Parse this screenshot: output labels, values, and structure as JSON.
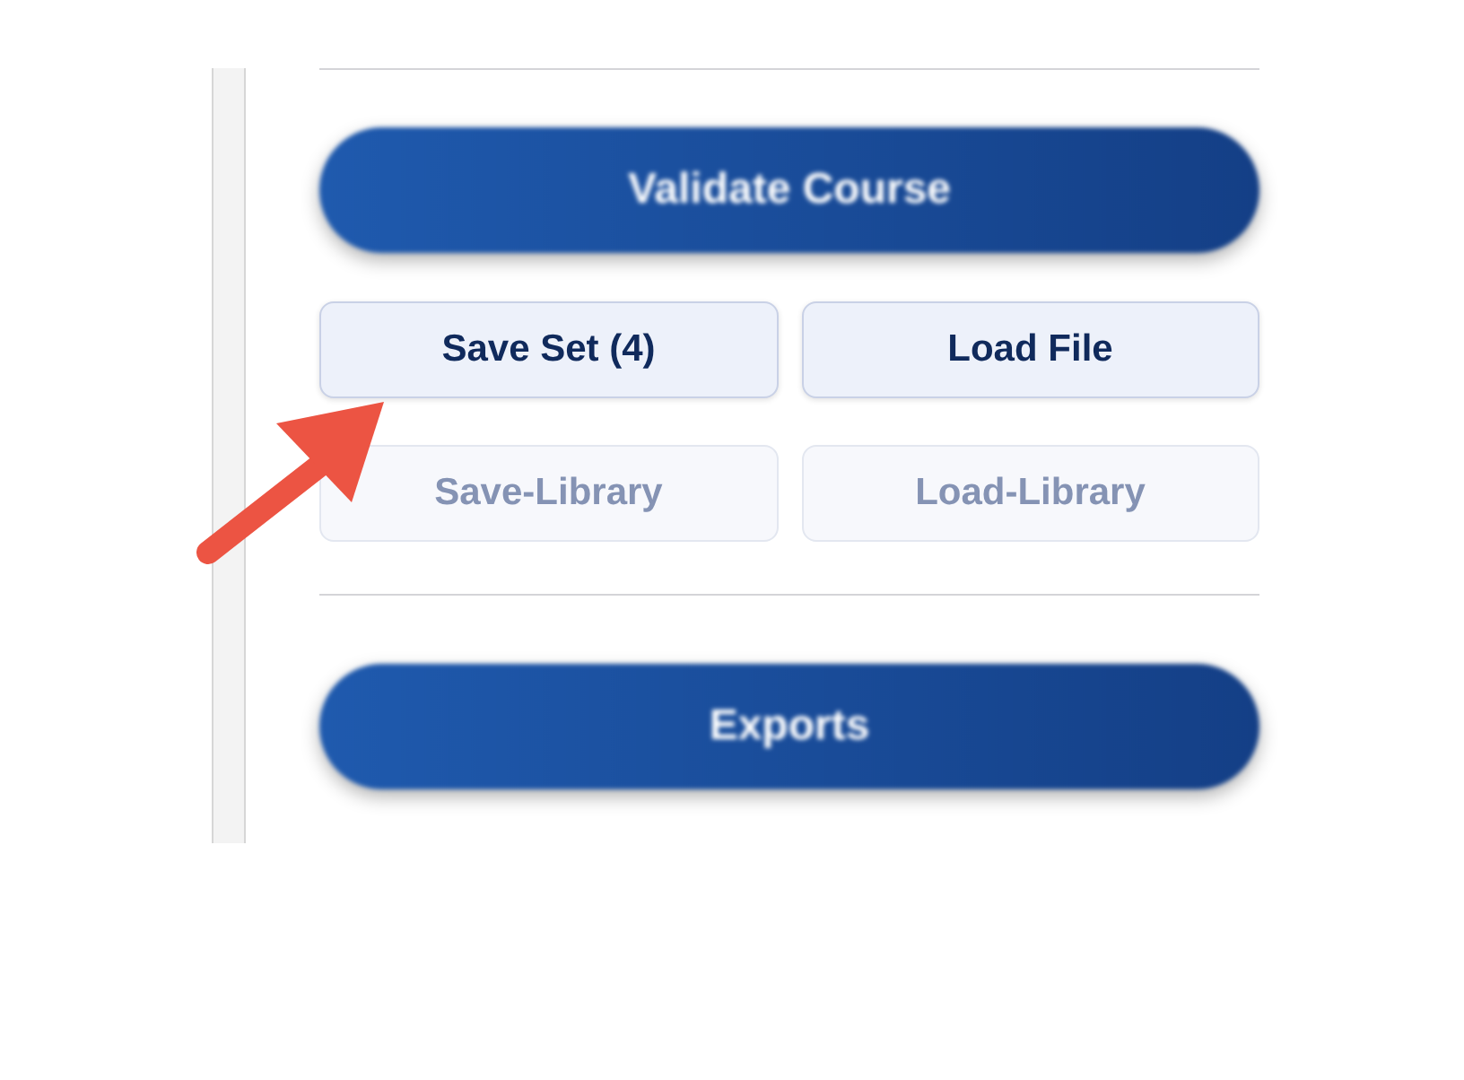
{
  "validate_button": {
    "label": "Validate Course"
  },
  "file_buttons": [
    {
      "label": "Save Set (4)",
      "disabled": false
    },
    {
      "label": "Load File",
      "disabled": false
    },
    {
      "label": "Save-Library",
      "disabled": true
    },
    {
      "label": "Load-Library",
      "disabled": true
    }
  ],
  "exports_button": {
    "label": "Exports"
  }
}
